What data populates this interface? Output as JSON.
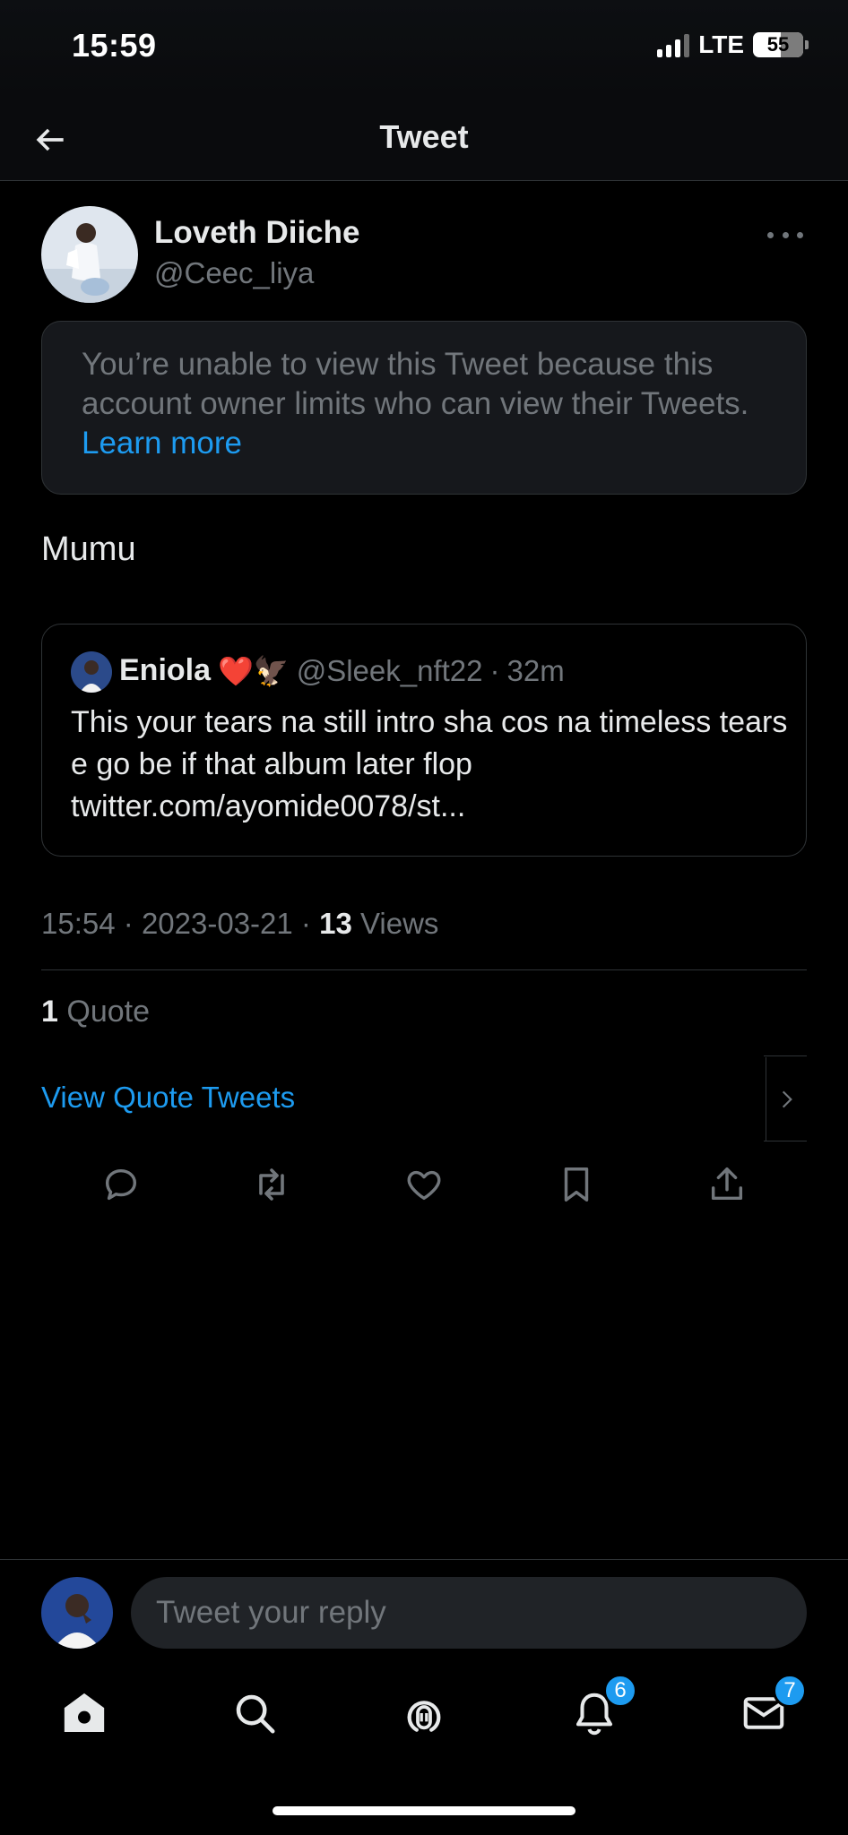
{
  "status_bar": {
    "time": "15:59",
    "network": "LTE",
    "battery": "55"
  },
  "header": {
    "title": "Tweet"
  },
  "author": {
    "name": "Loveth Diiche",
    "handle": "@Ceec_liya"
  },
  "notice": {
    "text": "You’re unable to view this Tweet because this account owner limits who can view their Tweets.",
    "link": "Learn more"
  },
  "tweet": {
    "text": "Mumu"
  },
  "quoted": {
    "name": "Eniola",
    "emoji": "❤️🦅",
    "handle": "@Sleek_nft22",
    "separator": "·",
    "time": "32m",
    "text": "This your tears na still intro sha cos na timeless tears e go be if that album later flop twitter.com/ayomide0078/st..."
  },
  "meta": {
    "time": "15:54",
    "date": "2023-03-21",
    "views_count": "13",
    "views_label": "Views",
    "separator": "·"
  },
  "quotes": {
    "count": "1",
    "label": "Quote",
    "view_link": "View Quote Tweets"
  },
  "reply": {
    "placeholder": "Tweet your reply"
  },
  "tabs": {
    "notifications_badge": "6",
    "messages_badge": "7"
  },
  "colors": {
    "accent": "#1d9bf0",
    "background": "#000000",
    "muted": "#71767b"
  }
}
